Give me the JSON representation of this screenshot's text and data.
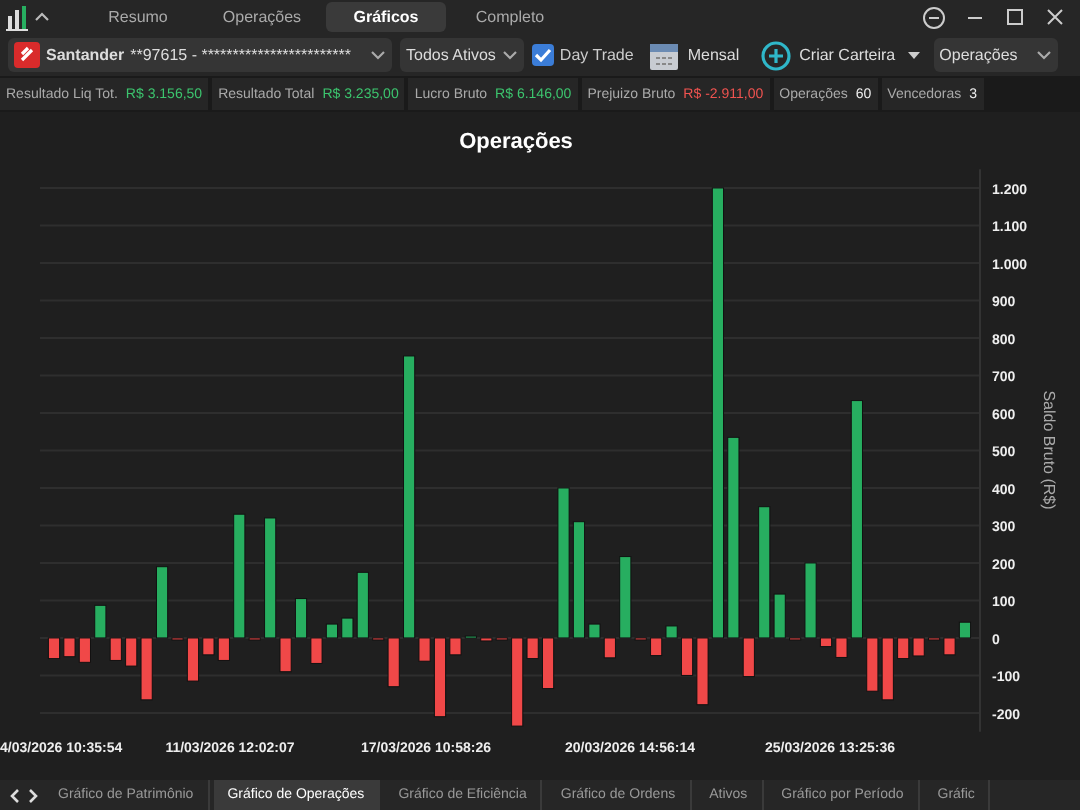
{
  "top_tabs": [
    {
      "label": "Resumo",
      "selected": false
    },
    {
      "label": "Operações",
      "selected": false
    },
    {
      "label": "Gráficos",
      "selected": true
    },
    {
      "label": "Completo",
      "selected": false
    }
  ],
  "toolbar": {
    "account": {
      "bank": "Santander",
      "number": "**97615 - ************************"
    },
    "asset_filter": "Todos Ativos",
    "day_trade": {
      "label": "Day Trade",
      "checked": true
    },
    "period": "Mensal",
    "create_portfolio": "Criar Carteira",
    "view": "Operações"
  },
  "stats": [
    {
      "label": "Resultado Liq Tot.",
      "value": "R$ 3.156,50",
      "color": "#3cc46e"
    },
    {
      "label": "Resultado Total",
      "value": "R$ 3.235,00",
      "color": "#3cc46e"
    },
    {
      "label": "Lucro Bruto",
      "value": "R$ 6.146,00",
      "color": "#3cc46e"
    },
    {
      "label": "Prejuizo Bruto",
      "value": "R$ -2.911,00",
      "color": "#ef5350"
    },
    {
      "label": "Operações",
      "value": "60",
      "color": "#eeeeee"
    },
    {
      "label": "Vencedoras",
      "value": "3",
      "color": "#eeeeee"
    }
  ],
  "chart": {
    "x_labels": [
      "4/03/2026 10:35:54",
      "11/03/2026 12:02:07",
      "17/03/2026 10:58:26",
      "20/03/2026 14:56:14",
      "25/03/2026 13:25:36"
    ],
    "chart_data": {
      "type": "bar",
      "title": "Operações",
      "ylabel": "Saldo Bruto (R$)",
      "ylim": [
        -250,
        1250
      ],
      "grid": true,
      "yticks": [
        {
          "value": 1200,
          "label": "1.200"
        },
        {
          "value": 1100,
          "label": "1.100"
        },
        {
          "value": 1000,
          "label": "1.000"
        },
        900,
        800,
        700,
        600,
        500,
        400,
        300,
        200,
        100,
        0,
        -100,
        -200
      ],
      "series": [
        {
          "values": [
            -55,
            -50,
            -65,
            87,
            -60,
            -75,
            -165,
            190,
            -5,
            -115,
            -45,
            -60,
            330,
            -5,
            320,
            -90,
            105,
            -68,
            37,
            53,
            175,
            -5,
            -130,
            752,
            -62,
            -210,
            -45,
            5,
            -8,
            -2,
            -235,
            -55,
            -135,
            400,
            310,
            37,
            -53,
            217,
            -5,
            -47,
            32,
            -100,
            -178,
            1200,
            535,
            -103,
            350,
            117,
            -5,
            200,
            -23,
            -52,
            633,
            -142,
            -165,
            -55,
            -48,
            -5,
            -45,
            42
          ]
        }
      ]
    }
  },
  "bottom_tabs": [
    {
      "label": "Gráfico de Patrimônio",
      "selected": false
    },
    {
      "label": "Gráfico de Operações",
      "selected": true
    },
    {
      "label": "Gráfico de Eficiência",
      "selected": false
    },
    {
      "label": "Gráfico de Ordens",
      "selected": false
    },
    {
      "label": "Ativos",
      "selected": false
    },
    {
      "label": "Gráfico por Período",
      "selected": false
    },
    {
      "label": "Gráfic",
      "selected": false
    }
  ]
}
